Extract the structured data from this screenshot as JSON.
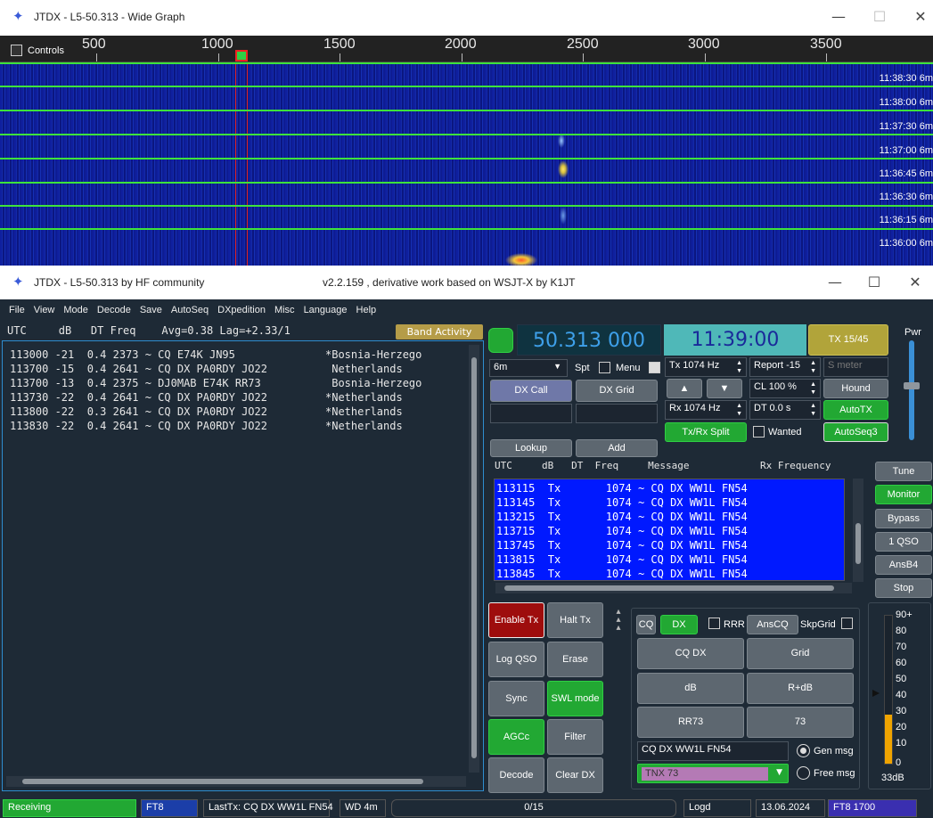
{
  "wide_graph": {
    "title": "JTDX - L5-50.313 - Wide Graph",
    "controls_label": "Controls",
    "ruler": [
      "500",
      "1000",
      "1500",
      "2000",
      "2500",
      "3000",
      "3500"
    ],
    "timestamps": [
      "11:38:30",
      "11:38:00",
      "11:37:30",
      "11:37:00",
      "11:36:45",
      "11:36:30",
      "11:36:15",
      "11:36:00"
    ],
    "band": "6m"
  },
  "main": {
    "title": "JTDX - L5-50.313  by HF community",
    "subtitle": "v2.2.159 , derivative work based on WSJT-X by K1JT",
    "menu": [
      "File",
      "View",
      "Mode",
      "Decode",
      "Save",
      "AutoSeq",
      "DXpedition",
      "Misc",
      "Language",
      "Help"
    ],
    "band_header": "UTC     dB   DT Freq    Avg=0.38 Lag=+2.33/1",
    "band_activity_label": "Band Activity",
    "band_lines": [
      "113000 -21  0.4 2373 ~ CQ E74K JN95              *Bosnia-Herzego",
      "113700 -15  0.4 2641 ~ CQ DX PA0RDY JO22          Netherlands",
      "113700 -13  0.4 2375 ~ DJ0MAB E74K RR73           Bosnia-Herzego",
      "113730 -22  0.4 2641 ~ CQ DX PA0RDY JO22         *Netherlands",
      "113800 -22  0.3 2641 ~ CQ DX PA0RDY JO22         *Netherlands",
      "113830 -22  0.4 2641 ~ CQ DX PA0RDY JO22         *Netherlands"
    ],
    "frequency": "50.313 000",
    "time": "11:39:00",
    "tx_period": "TX 15/45",
    "pwr_label": "Pwr",
    "band_select": "6m",
    "spt_label": "Spt",
    "menu_label": "Menu",
    "tx_hz": "Tx  1074  Hz",
    "rx_hz": "Rx  1074  Hz",
    "report": "Report -15",
    "smeter_placeholder": "S meter",
    "cl": "CL  100 %",
    "dt": "DT 0.0 s",
    "up_arrow": "▲",
    "down_arrow": "▼",
    "dx_call_btn": "DX Call",
    "dx_grid_btn": "DX Grid",
    "lookup_btn": "Lookup",
    "add_btn": "Add",
    "hound_btn": "Hound",
    "autotx_btn": "AutoTX",
    "txrx_split_btn": "Tx/Rx Split",
    "wanted_label": "Wanted",
    "autoseq3_btn": "AutoSeq3",
    "rx_header": "UTC     dB   DT  Freq     Message            Rx Frequency",
    "rx_lines": [
      "113115  Tx       1074 ~ CQ DX WW1L FN54",
      "113145  Tx       1074 ~ CQ DX WW1L FN54",
      "113215  Tx       1074 ~ CQ DX WW1L FN54",
      "113715  Tx       1074 ~ CQ DX WW1L FN54",
      "113745  Tx       1074 ~ CQ DX WW1L FN54",
      "113815  Tx       1074 ~ CQ DX WW1L FN54",
      "113845  Tx       1074 ~ CQ DX WW1L FN54"
    ],
    "side_buttons": [
      "Tune",
      "Monitor",
      "Bypass",
      "1 QSO",
      "AnsB4",
      "Stop"
    ],
    "enable_tx": "Enable Tx",
    "halt_tx": "Halt Tx",
    "log_qso": "Log QSO",
    "erase": "Erase",
    "sync": "Sync",
    "swl_mode": "SWL mode",
    "agcc": "AGCc",
    "filter": "Filter",
    "decode": "Decode",
    "clear_dx": "Clear DX",
    "cq_label": "CQ",
    "dx_label": "DX",
    "rrr_label": "RRR",
    "anscq_btn": "AnsCQ",
    "skpgrid_label": "SkpGrid",
    "msg_buttons": [
      "CQ DX",
      "Grid",
      "dB",
      "R+dB",
      "RR73",
      "73"
    ],
    "gen_msg_field": "CQ DX WW1L FN54",
    "free_msg_field": "TNX 73",
    "gen_msg_label": "Gen msg",
    "free_msg_label": "Free msg",
    "meter_scale": [
      "90+",
      "80",
      "70",
      "60",
      "50",
      "40",
      "30",
      "20",
      "10",
      "0"
    ],
    "meter_level_db": "33dB",
    "meter_fraction": 0.33,
    "pwr_fraction": 0.55
  },
  "status": {
    "receiving": "Receiving",
    "mode": "FT8",
    "last_tx": "LastTx: CQ DX WW1L FN54",
    "wd": "WD 4m",
    "progress": "0/15",
    "progress_fraction": 0.0,
    "logd": "Logd",
    "date": "13.06.2024",
    "mode_freq": "FT8  1700"
  },
  "colors": {
    "accent_green": "#22a833",
    "tx_list_bg": "#0019ff",
    "enable_tx": "#9e0d0d",
    "time_bg": "#4fb8b8"
  }
}
